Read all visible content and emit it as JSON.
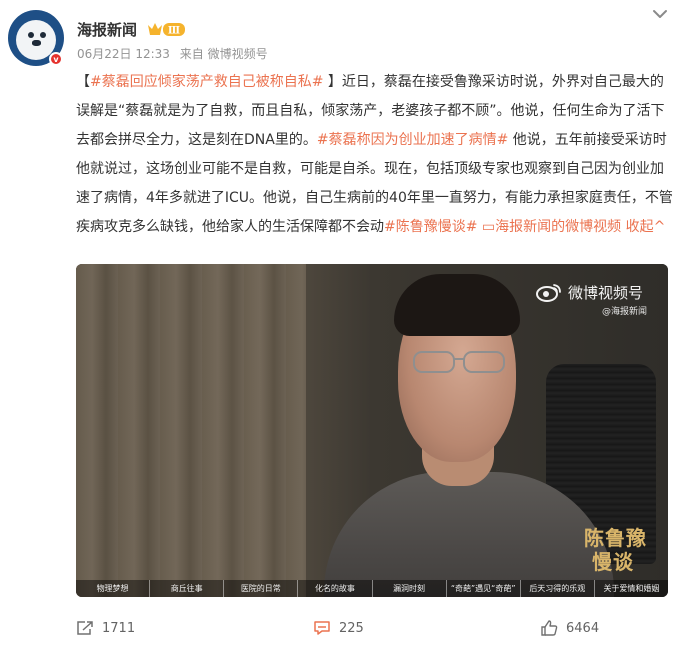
{
  "post": {
    "author": "海报新闻",
    "member_level": "Ⅲ",
    "verified_mark": "v",
    "date": "06月22日 12:33",
    "source": "来自 微博视频号"
  },
  "content": {
    "bracket_open": "【",
    "headline_tag": "#蔡磊回应倾家荡产救自己被称自私#",
    "bracket_close": " 】",
    "part1": "近日，蔡磊在接受鲁豫采访时说，外界对自己最大的误解是“蔡磊就是为了自救，而且自私，倾家荡产，老婆孩子都不顾”。他说，任何生命为了活下去都会拼尽全力，这是刻在DNA里的。",
    "topic2": "#蔡磊称因为创业加速了病情#",
    "part2": " 他说，五年前接受采访时他就说过，这场创业可能不是自救，可能是自杀。现在，包括顶级专家也观察到自己因为创业加速了病情，4年多就进了ICU。他说，自己生病前的40年里一直努力，有能力承担家庭责任，不管疾病攻克多么缺钱，他给家人的生活保障都不会动",
    "topic3": "#陈鲁豫慢谈#",
    "video_link": " ▭海报新闻的微博视频",
    "collapse": " 收起^"
  },
  "video": {
    "watermark_main": "微博视频号",
    "watermark_sub": "@海报新闻",
    "show_logo_line1": "陈鲁豫",
    "show_logo_line2": "慢谈",
    "chapters": [
      "物理梦想",
      "商丘往事",
      "医院的日常",
      "化名的故事",
      "漏洞时刻",
      "“奇葩”遇见“奇葩”",
      "后天习得的乐观",
      "关于爱情和婚姻"
    ]
  },
  "actions": {
    "share_count": "1711",
    "comment_count": "225",
    "like_count": "6464"
  },
  "colors": {
    "topic": "#eb7350",
    "meta": "#939393",
    "comment_icon": "#eb7350"
  }
}
